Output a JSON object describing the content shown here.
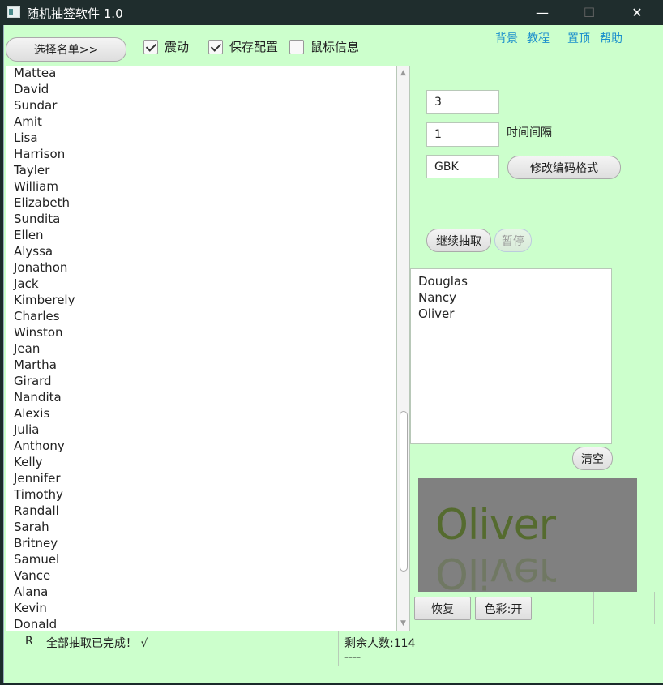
{
  "window": {
    "title": "随机抽签软件 1.0",
    "minimize_glyph": "—",
    "maximize_glyph": "☐",
    "close_glyph": "✕"
  },
  "toolbar": {
    "select_list_label": "选择名单>>",
    "vibrate_label": "震动",
    "vibrate_checked": true,
    "save_config_label": "保存配置",
    "save_config_checked": true,
    "mouse_info_label": "鼠标信息",
    "mouse_info_checked": false
  },
  "top_links": [
    "背景",
    "教程",
    "置顶",
    "帮助"
  ],
  "name_list": [
    "Mattea",
    "David",
    "Sundar",
    "Amit",
    "Lisa",
    "Harrison",
    "Tayler",
    "William",
    "Elizabeth",
    "Sundita",
    "Ellen",
    "Alyssa",
    "Jonathon",
    "Jack",
    "Kimberely",
    "Charles",
    "Winston",
    "Jean",
    "Martha",
    "Girard",
    "Nandita",
    "Alexis",
    "Julia",
    "Anthony",
    "Kelly",
    "Jennifer",
    "Timothy",
    "Randall",
    "Sarah",
    "Britney",
    "Samuel",
    "Vance",
    "Alana",
    "Kevin",
    "Donald"
  ],
  "settings": {
    "count_value": "3",
    "interval_value": "1",
    "interval_label": "时间间隔",
    "encoding_value": "GBK",
    "change_encoding_label": "修改编码格式"
  },
  "controls": {
    "continue_label": "继续抽取",
    "pause_label": "暂停",
    "clear_label": "清空"
  },
  "results": [
    "Douglas",
    "Nancy",
    "Oliver"
  ],
  "display": {
    "current_name": "Oliver",
    "background": "#808080",
    "text_color": "#556b2f"
  },
  "bottom_buttons": {
    "restore_label": "恢复",
    "color_label": "色彩:开"
  },
  "statusbar": {
    "mode": "R",
    "message": "全部抽取已完成！ √",
    "remaining": "剩余人数:114",
    "extra": "----"
  },
  "colors": {
    "client_bg": "#ccffcc",
    "link": "#1a8fcc",
    "titlebar": "#1f2d2d"
  }
}
